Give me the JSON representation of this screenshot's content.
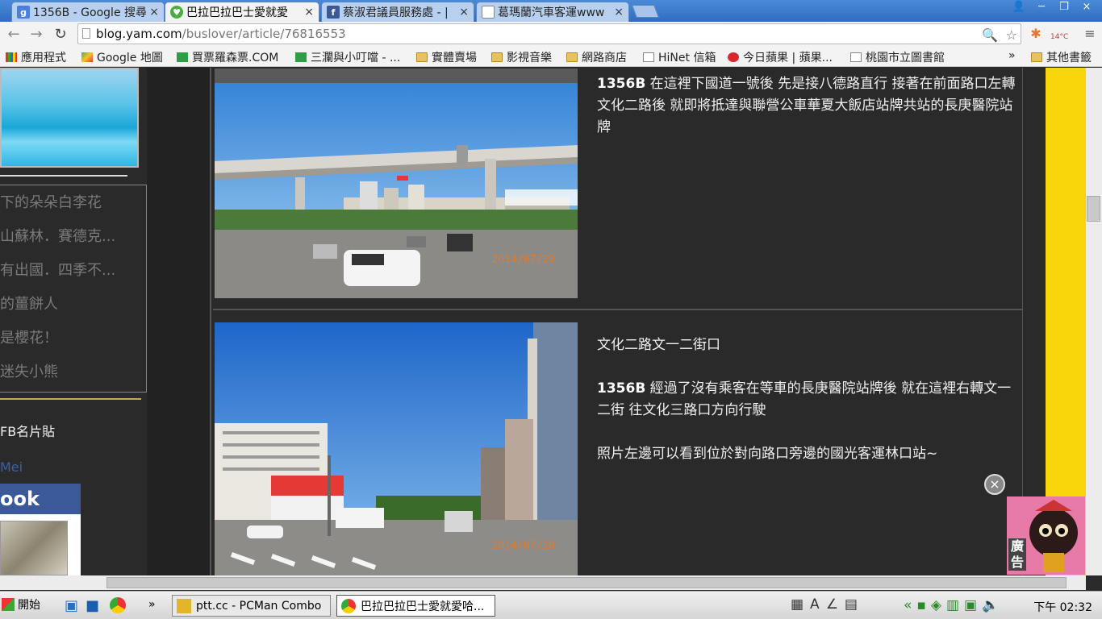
{
  "browser": {
    "tabs": [
      {
        "label": "1356B - Google 搜尋",
        "icon": "google-icon",
        "active": false
      },
      {
        "label": "巴拉巴拉巴士愛就愛",
        "icon": "blog-heart-icon",
        "active": true
      },
      {
        "label": "蔡淑君議員服務處 - |",
        "icon": "facebook-icon",
        "active": false
      },
      {
        "label": "葛瑪蘭汽車客運www",
        "icon": "page-icon",
        "active": false
      }
    ],
    "close_glyph": "×",
    "url_host": "blog.yam.com",
    "url_path": "/buslover/article/76816553",
    "weather_temp": "14°C",
    "bookmarks": [
      {
        "label": "應用程式",
        "icon": "apps-icon"
      },
      {
        "label": "Google 地圖",
        "icon": "maps-icon"
      },
      {
        "label": "買票羅森票.COM",
        "icon": "sheet-icon"
      },
      {
        "label": "三瀾與小叮噹 - ...",
        "icon": "sheet-icon"
      },
      {
        "label": "實體賣場",
        "icon": "folder-icon"
      },
      {
        "label": "影視音樂",
        "icon": "folder-icon"
      },
      {
        "label": "網路商店",
        "icon": "folder-icon"
      },
      {
        "label": "HiNet 信箱",
        "icon": "page-icon"
      },
      {
        "label": "今日蘋果 | 蘋果...",
        "icon": "apple-icon"
      },
      {
        "label": "桃園市立圖書館",
        "icon": "page-icon"
      }
    ],
    "bookmarks_overflow": "»",
    "other_bookmarks": "其他書籤"
  },
  "sidebar": {
    "links": [
      "下的朵朵白李花",
      "山蘇林．賽德克...",
      "有出國．四季不...",
      "的薑餅人",
      "是櫻花！",
      "迷失小熊"
    ],
    "fb_header": "FB名片貼",
    "fb_name": "Mei",
    "fb_logo": "ook"
  },
  "posts": [
    {
      "date": "2014/07/29",
      "bus": "1356B",
      "text": " 在這裡下國道一號後 先是接八德路直行 接著在前面路口左轉文化二路後 就即將抵達與聯營公車華夏大飯店站牌共站的長庚醫院站牌"
    },
    {
      "date": "2014/07/29",
      "heading": "文化二路文一二街口",
      "bus": "1356B",
      "text": " 經過了沒有乘客在等車的長庚醫院站牌後 就在這裡右轉文一二街 往文化三路口方向行駛",
      "text2": "照片左邊可以看到位於對向路口旁邊的國光客運林口站~"
    }
  ],
  "ad": {
    "label": "廣告",
    "close": "×"
  },
  "taskbar": {
    "start": "開始",
    "overflow": "»",
    "windows": [
      {
        "label": "ptt.cc - PCMan Combo",
        "active": false
      },
      {
        "label": "巴拉巴拉巴士愛就愛哈...",
        "active": true
      }
    ],
    "clock": "下午 02:32"
  }
}
